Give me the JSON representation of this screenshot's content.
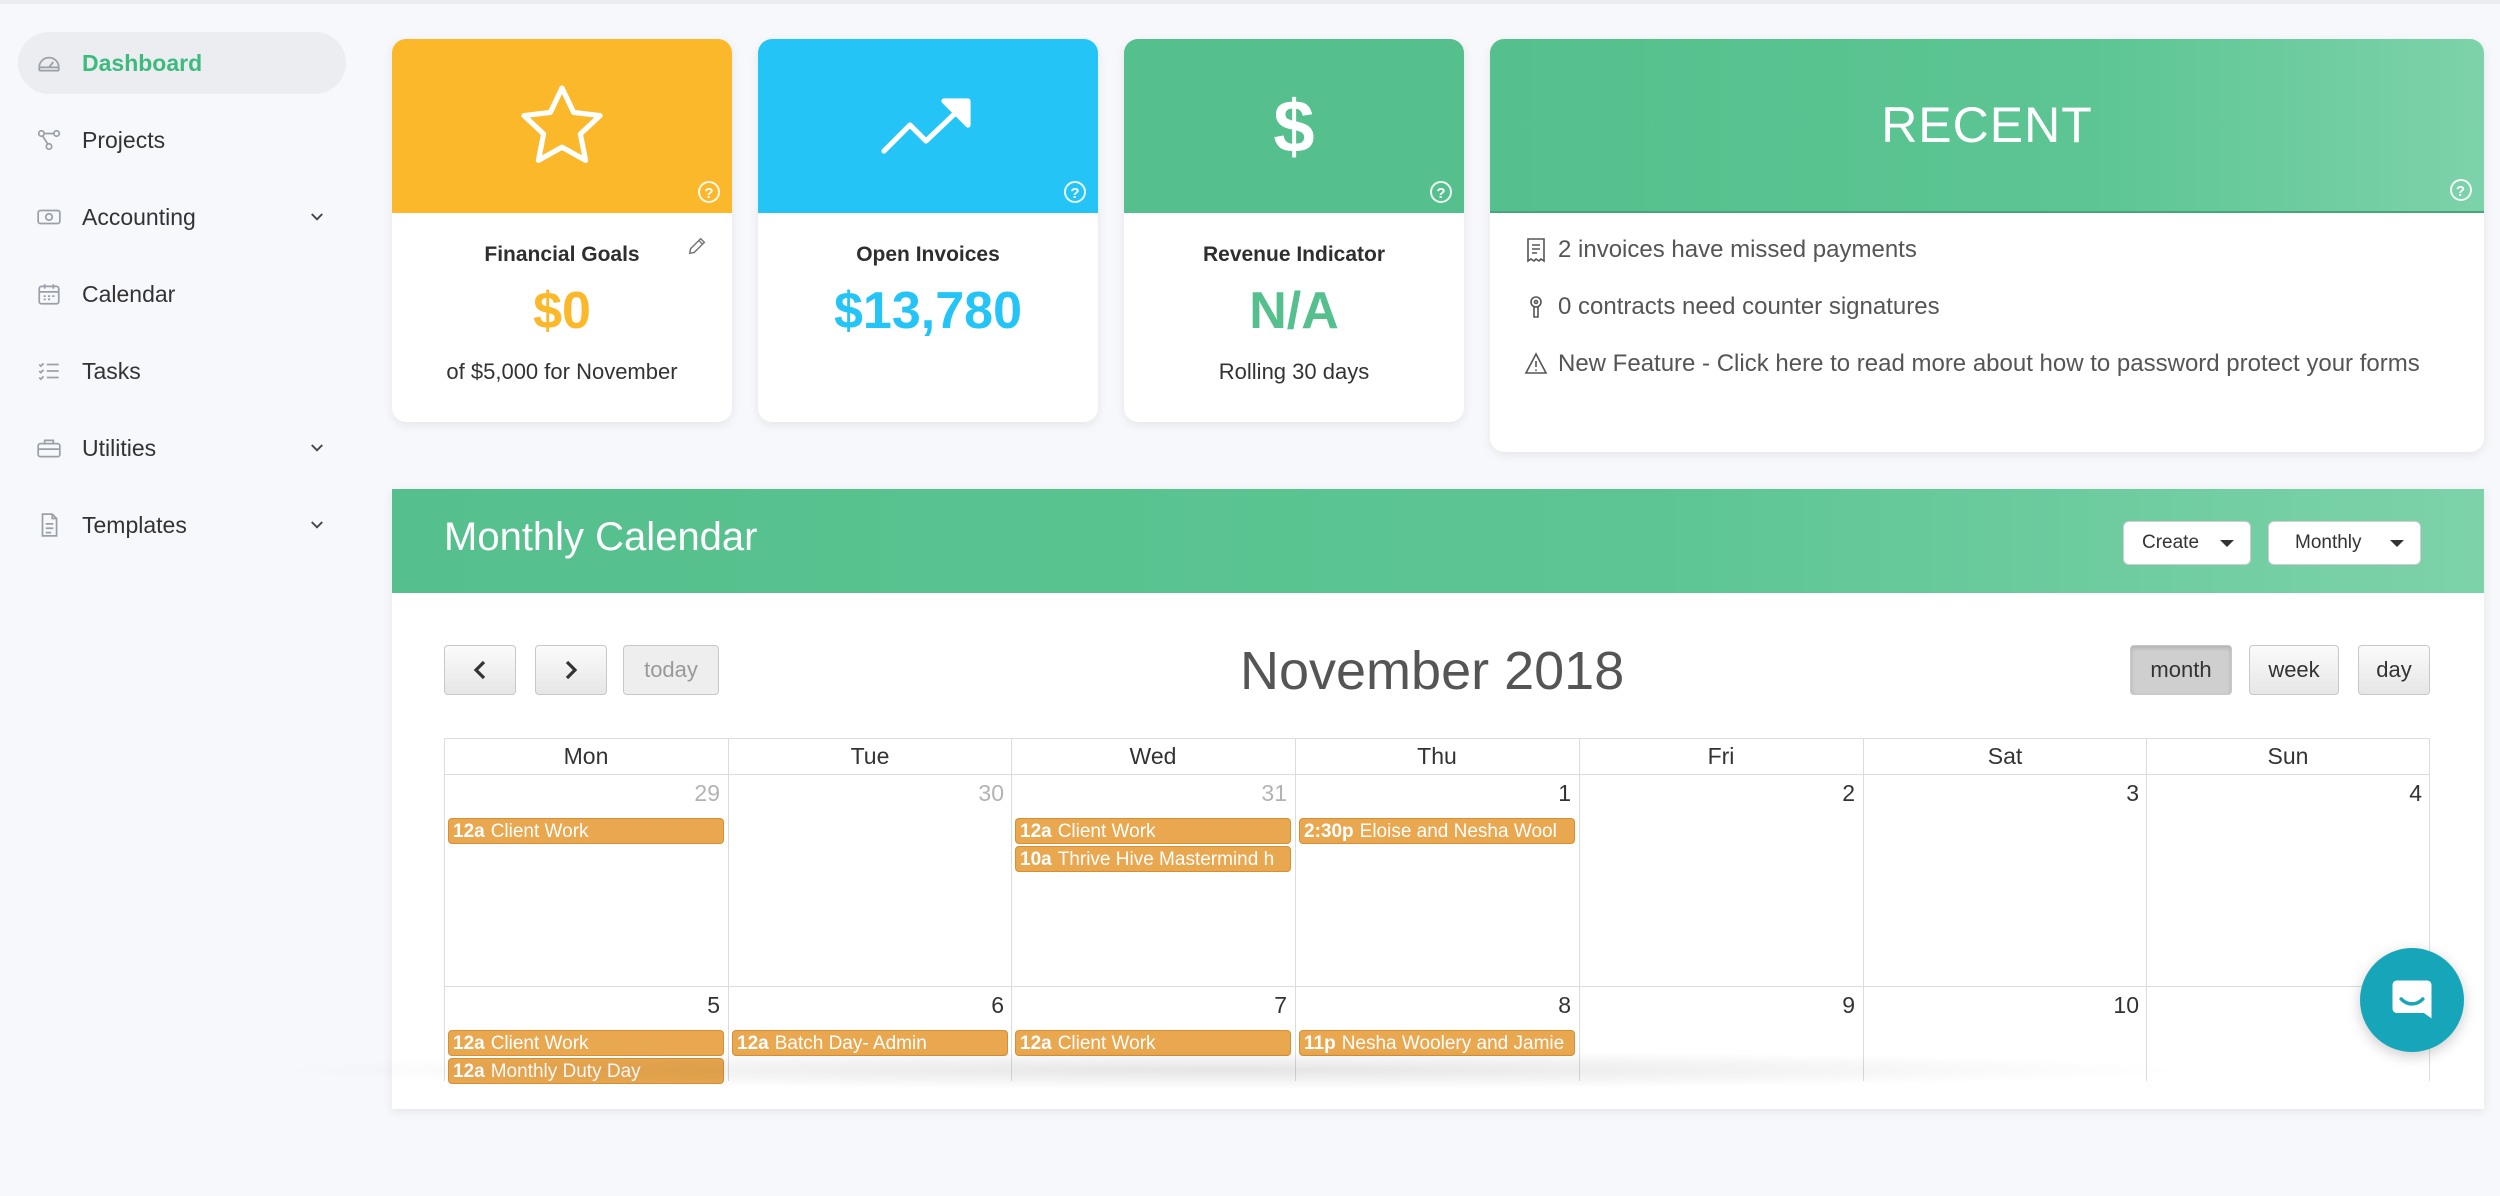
{
  "sidebar": {
    "items": [
      {
        "label": "Dashboard",
        "icon": "dashboard-icon",
        "active": true
      },
      {
        "label": "Projects",
        "icon": "projects-icon"
      },
      {
        "label": "Accounting",
        "icon": "accounting-icon",
        "expandable": true
      },
      {
        "label": "Calendar",
        "icon": "calendar-icon"
      },
      {
        "label": "Tasks",
        "icon": "tasks-icon"
      },
      {
        "label": "Utilities",
        "icon": "utilities-icon",
        "expandable": true
      },
      {
        "label": "Templates",
        "icon": "templates-icon",
        "expandable": true
      }
    ]
  },
  "cards": {
    "financial": {
      "title": "Financial Goals",
      "value": "$0",
      "sub": "of $5,000 for November",
      "color": "#fbb82b",
      "value_color": "#fbb82b",
      "icon": "star-icon"
    },
    "invoices": {
      "title": "Open Invoices",
      "value": "$13,780",
      "color": "#24c5f6",
      "value_color": "#24c5f6",
      "icon": "trend-up-icon"
    },
    "revenue": {
      "title": "Revenue Indicator",
      "value": "N/A",
      "sub": "Rolling 30 days",
      "color": "#55c08d",
      "value_color": "#55c08d",
      "icon": "dollar-icon",
      "icon_text": "$"
    }
  },
  "recent": {
    "title": "RECENT",
    "items": [
      {
        "icon": "receipt-icon",
        "text": "2 invoices have missed payments"
      },
      {
        "icon": "pen-nib-icon",
        "text": "0 contracts need counter signatures"
      },
      {
        "icon": "warning-icon",
        "text": "New Feature - Click here to read more about how to password protect your forms"
      }
    ]
  },
  "calendar": {
    "panel_title": "Monthly Calendar",
    "create_label": "Create",
    "view_select_label": "Monthly",
    "today_label": "today",
    "title": "November 2018",
    "views": [
      "month",
      "week",
      "day"
    ],
    "active_view": "month",
    "weekdays": [
      "Mon",
      "Tue",
      "Wed",
      "Thu",
      "Fri",
      "Sat",
      "Sun"
    ],
    "weeks": [
      {
        "days": [
          {
            "num": "29",
            "other": true,
            "events": [
              {
                "time": "12a",
                "title": "Client Work"
              }
            ]
          },
          {
            "num": "30",
            "other": true,
            "events": []
          },
          {
            "num": "31",
            "other": true,
            "events": [
              {
                "time": "12a",
                "title": "Client Work"
              },
              {
                "time": "10a",
                "title": "Thrive Hive Mastermind h"
              }
            ]
          },
          {
            "num": "1",
            "events": [
              {
                "time": "2:30p",
                "title": "Eloise and Nesha Wool"
              }
            ]
          },
          {
            "num": "2",
            "events": []
          },
          {
            "num": "3",
            "events": []
          },
          {
            "num": "4",
            "events": []
          }
        ]
      },
      {
        "days": [
          {
            "num": "5",
            "events": [
              {
                "time": "12a",
                "title": "Client Work"
              },
              {
                "time": "12a",
                "title": "Monthly Duty Day"
              }
            ]
          },
          {
            "num": "6",
            "events": [
              {
                "time": "12a",
                "title": "Batch Day- Admin"
              }
            ]
          },
          {
            "num": "7",
            "events": [
              {
                "time": "12a",
                "title": "Client Work"
              }
            ]
          },
          {
            "num": "8",
            "events": [
              {
                "time": "11p",
                "title": "Nesha Woolery and Jamie"
              }
            ]
          },
          {
            "num": "9",
            "events": []
          },
          {
            "num": "10",
            "events": []
          },
          {
            "num": "",
            "events": []
          }
        ]
      }
    ]
  }
}
